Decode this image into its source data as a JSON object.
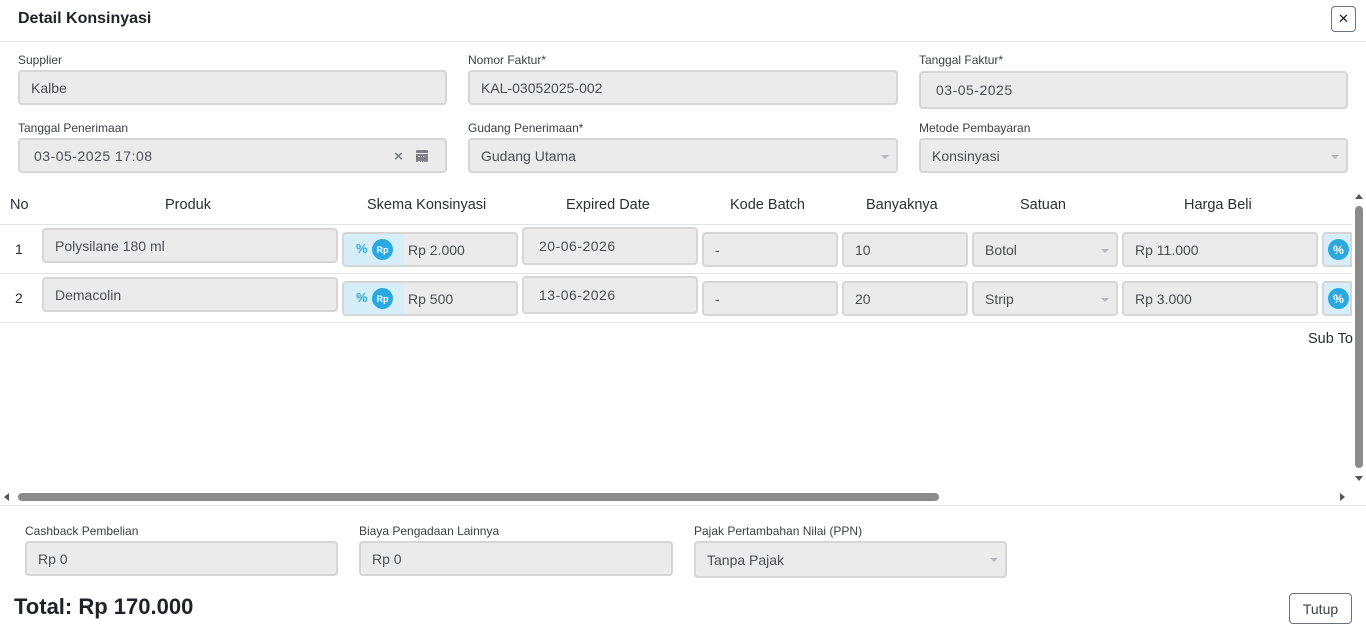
{
  "header": {
    "title": "Detail Konsinyasi",
    "close_icon": "close-icon"
  },
  "form": {
    "supplier": {
      "label": "Supplier",
      "value": "Kalbe"
    },
    "nomor_faktur": {
      "label": "Nomor Faktur*",
      "value": "KAL-03052025-002"
    },
    "tanggal_faktur": {
      "label": "Tanggal Faktur*",
      "value": "03-05-2025"
    },
    "tanggal_penerimaan": {
      "label": "Tanggal Penerimaan",
      "value": "03-05-2025 17:08",
      "clear_icon": "×"
    },
    "gudang_penerimaan": {
      "label": "Gudang Penerimaan*",
      "value": "Gudang Utama"
    },
    "metode_pembayaran": {
      "label": "Metode Pembayaran",
      "value": "Konsinyasi"
    }
  },
  "table": {
    "headers": [
      "No",
      "Produk",
      "Skema Konsinyasi",
      "Expired Date",
      "Kode Batch",
      "Banyaknya",
      "Satuan",
      "Harga Beli"
    ],
    "pct_symbol": "%",
    "rp_symbol": "Rp",
    "rows": [
      {
        "no": "1",
        "produk": "Polysilane 180 ml",
        "skema": "Rp 2.000",
        "expired": "20-06-2026",
        "batch": "-",
        "banyak": "10",
        "satuan": "Botol",
        "harga": "Rp 11.000"
      },
      {
        "no": "2",
        "produk": "Demacolin",
        "skema": "Rp 500",
        "expired": "13-06-2026",
        "batch": "-",
        "banyak": "20",
        "satuan": "Strip",
        "harga": "Rp 3.000"
      }
    ],
    "subtotal_label": "Sub To"
  },
  "footer": {
    "cashback": {
      "label": "Cashback Pembelian",
      "value": "Rp 0"
    },
    "biaya": {
      "label": "Biaya Pengadaan Lainnya",
      "value": "Rp 0"
    },
    "ppn": {
      "label": "Pajak Pertambahan Nilai (PPN)",
      "value": "Tanpa Pajak"
    },
    "total": "Total: Rp 170.000",
    "close_button": "Tutup"
  },
  "colors": {
    "accent": "#2aa9e0",
    "field_bg": "#ebebeb",
    "field_border": "#d6d6d6"
  }
}
